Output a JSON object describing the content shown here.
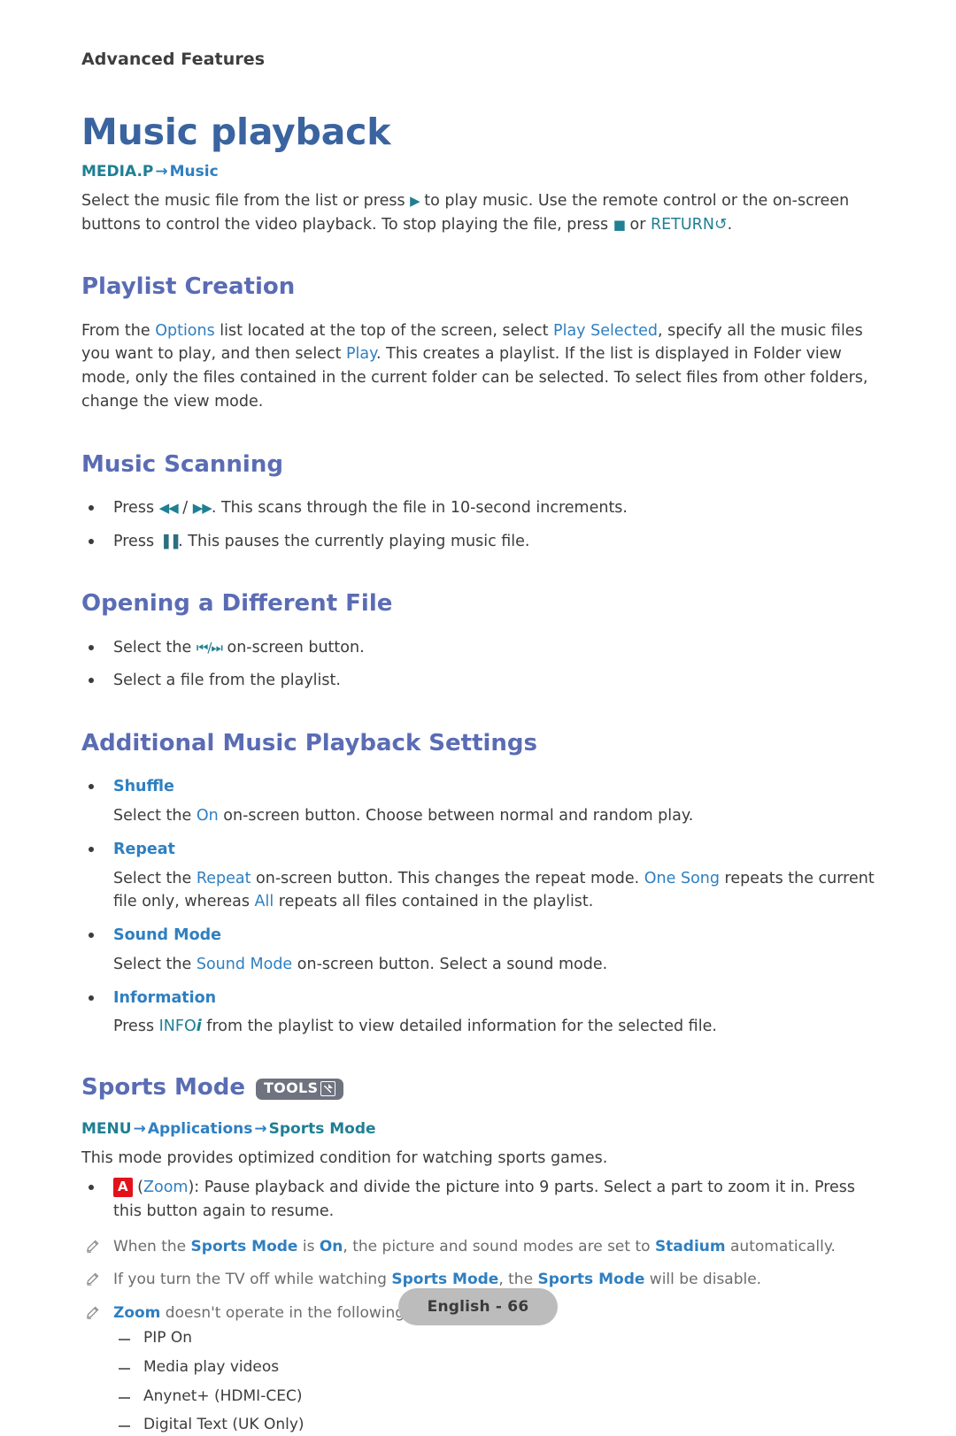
{
  "header": {
    "running_head": "Advanced Features"
  },
  "title": "Music playback",
  "breadcrumb_media": {
    "root": "MEDIA.P",
    "arrow": "→",
    "leaf": "Music"
  },
  "intro": {
    "part1": "Select the music file from the list or press ",
    "play_glyph": "▶",
    "part2": " to play music. Use the remote control or the on-screen buttons to control the video playback. To stop playing the file, press ",
    "stop_glyph": "■",
    "part3": " or ",
    "return_label": "RETURN",
    "return_glyph": "↺",
    "part4": "."
  },
  "sections": [
    {
      "heading": "Playlist Creation",
      "paragraph": {
        "t1": "From the ",
        "k1": "Options",
        "t2": " list located at the top of the screen, select ",
        "k2": "Play Selected",
        "t3": ", specify all the music files you want to play, and then select ",
        "k3": "Play",
        "t4": ". This creates a playlist. If the list is displayed in Folder view mode, only the files contained in the current folder can be selected. To select files from other folders, change the view mode."
      }
    },
    {
      "heading": "Music Scanning",
      "bullets": [
        {
          "t1": "Press ",
          "g1": "◀◀",
          "t2": " / ",
          "g2": "▶▶",
          "t3": ". This scans through the file in 10-second increments."
        },
        {
          "t1": "Press ",
          "g1": "▐▐",
          "t2": ". This pauses the currently playing music file."
        }
      ]
    },
    {
      "heading": "Opening a Different File",
      "bullets": [
        {
          "t1": "Select the ",
          "g1": "⏮",
          "t2": "/",
          "g2": "⏭",
          "t3": " on-screen button."
        },
        {
          "t1": "Select a file from the playlist."
        }
      ]
    },
    {
      "heading": "Additional Music Playback Settings",
      "items": [
        {
          "term": "Shuffle",
          "desc": {
            "t1": "Select the ",
            "k1": "On",
            "t2": " on-screen button. Choose between normal and random play."
          }
        },
        {
          "term": "Repeat",
          "desc": {
            "t1": "Select the ",
            "k1": "Repeat",
            "t2": " on-screen button. This changes the repeat mode. ",
            "k2": "One Song",
            "t3": " repeats the current file only, whereas ",
            "k3": "All",
            "t4": " repeats all files contained in the playlist."
          }
        },
        {
          "term": "Sound Mode",
          "desc": {
            "t1": "Select the ",
            "k1": "Sound Mode",
            "t2": " on-screen button. Select a sound mode."
          }
        },
        {
          "term": "Information",
          "desc": {
            "t1": "Press ",
            "k1": "INFO",
            "i1": "i",
            "t2": " from the playlist to view detailed information for the selected file."
          }
        }
      ]
    }
  ],
  "sports": {
    "heading": "Sports Mode",
    "badge": {
      "label": "TOOLS",
      "icon": "tools-window-icon"
    },
    "breadcrumb": {
      "root": "MENU",
      "arrow": "→",
      "mid": "Applications",
      "leaf": "Sports Mode"
    },
    "paragraph": "This mode provides optimized condition for watching sports games.",
    "zoom_bullet": {
      "key": "A",
      "t1": " (",
      "k1": "Zoom",
      "t2": "): Pause playback and divide the picture into 9 parts. Select a part to zoom it in. Press this button again to resume."
    },
    "notes": [
      {
        "t1": "When the ",
        "k1": "Sports Mode",
        "t2": " is ",
        "k2": "On",
        "t3": ", the picture and sound modes are set to ",
        "k3": "Stadium",
        "t4": " automatically."
      },
      {
        "t1": "If you turn the TV off while watching ",
        "k1": "Sports Mode",
        "t2": ", the ",
        "k2": "Sports Mode",
        "t3": " will be disable."
      },
      {
        "k1": "Zoom",
        "t1": " doesn't operate in the following modes:"
      }
    ],
    "unsupported_modes": [
      "PIP On",
      "Media play videos",
      "Anynet+ (HDMI-CEC)",
      "Digital Text (UK Only)"
    ]
  },
  "footer": {
    "page_label": "English - 66"
  },
  "colors": {
    "title_blue": "#3a649f",
    "heading_violet": "#5a6cb4",
    "link_blue": "#2f7fc0",
    "link_teal": "#1f7f93",
    "key_red": "#e3121a",
    "badge_gray": "#6f7380",
    "footer_gray": "#bcbcbc",
    "body_text": "#3c3c3c",
    "note_text": "#6c6c6c"
  }
}
